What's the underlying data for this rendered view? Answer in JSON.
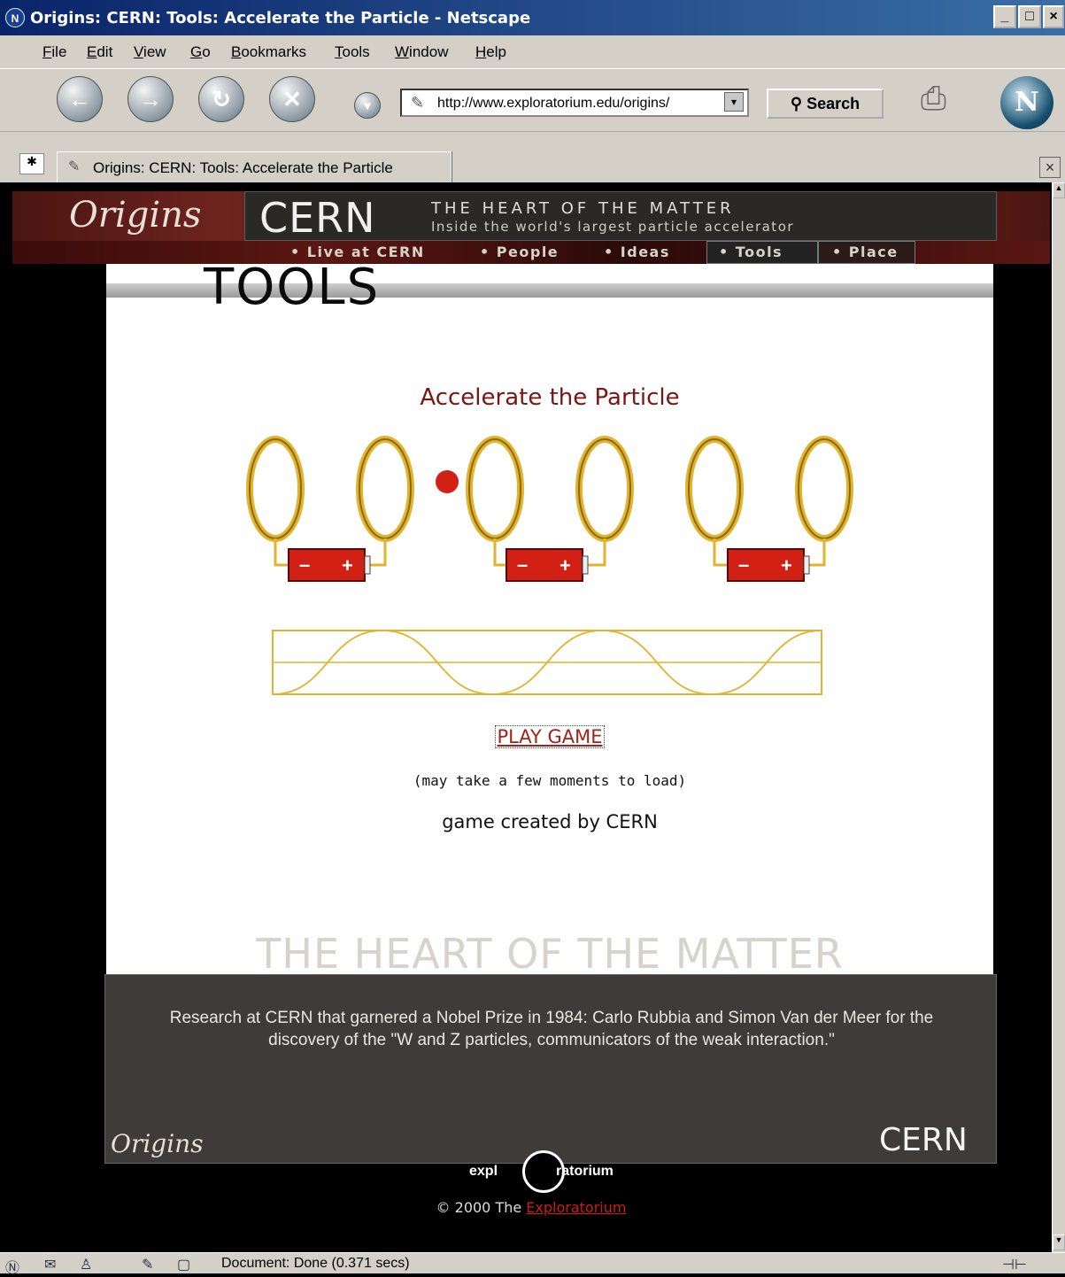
{
  "window": {
    "title": "Origins: CERN: Tools: Accelerate the Particle - Netscape",
    "min_label": "_",
    "max_label": "□",
    "close_label": "×"
  },
  "menu": [
    "File",
    "Edit",
    "View",
    "Go",
    "Bookmarks",
    "Tools",
    "Window",
    "Help"
  ],
  "toolbar": {
    "url": "http://www.exploratorium.edu/origins/",
    "search_label": "Search",
    "netscape_logo": "N"
  },
  "tab": {
    "label": "Origins: CERN: Tools: Accelerate the Particle"
  },
  "page": {
    "banner": {
      "origins": "Origins",
      "cern": "CERN",
      "tagline": "THE HEART OF THE MATTER",
      "subtitle": "Inside the world's largest particle accelerator"
    },
    "nav": [
      "• Live at CERN",
      "• People",
      "• Ideas",
      "• Tools",
      "• Place"
    ],
    "section_title": "TOOLS",
    "game_title": "Accelerate the Particle",
    "play_label": "PLAY GAME",
    "load_note": "(may take a few moments to load)",
    "credit": "game created by CERN",
    "watermark": "THE HEART OF THE MATTER",
    "nobel_text": "Research at CERN that garnered a Nobel Prize in 1984: Carlo Rubbia and Simon Van der Meer for the discovery of the \"W and Z particles, communicators of the weak interaction.\"",
    "footer_origins": "Origins",
    "footer_cern": "CERN",
    "explo_left": "expl",
    "explo_right": "ratorium",
    "copyright": "© 2000 The ",
    "copyright_link": "Exploratorium"
  },
  "status": {
    "text": "Document: Done (0.371 secs)"
  },
  "colors": {
    "accent": "#7a1512",
    "link": "#a0221c",
    "gold": "#e2b32c",
    "battery": "#d32014"
  }
}
